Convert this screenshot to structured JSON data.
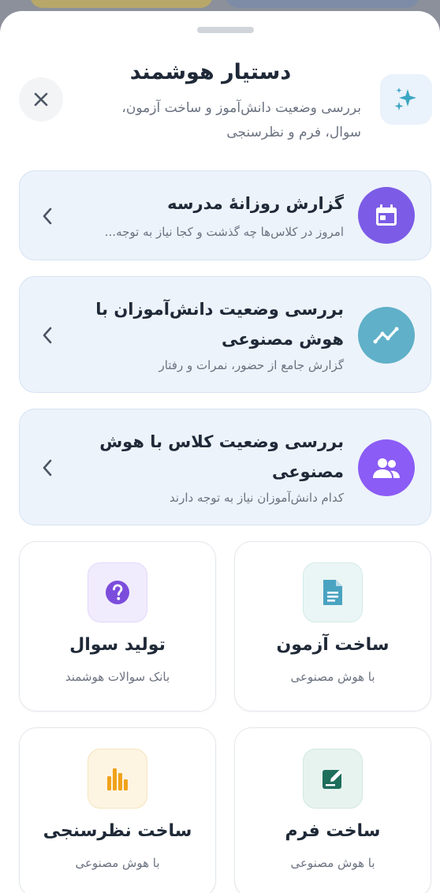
{
  "header": {
    "title": "دستیار هوشمند",
    "subtitle": "بررسی وضعیت دانش‌آموز و ساخت آزمون، سوال، فرم و نظرسنجی"
  },
  "actions": [
    {
      "title": "گزارش روزانهٔ مدرسه",
      "desc": "امروز در کلاس‌ها چه گذشت و کجا نیاز به توجه...",
      "icon": "calendar-icon",
      "color": "#7c5ce6"
    },
    {
      "title": "بررسی وضعیت دانش‌آموزان با هوش مصنوعی",
      "desc": "گزارش جامع از حضور، نمرات و رفتار",
      "icon": "trend-icon",
      "color": "#5fb0c8"
    },
    {
      "title": "بررسی وضعیت کلاس با هوش مصنوعی",
      "desc": "کدام دانش‌آموزان نیاز به توجه دارند",
      "icon": "group-icon",
      "color": "#8b5cf6"
    }
  ],
  "tiles": [
    {
      "label": "ساخت آزمون",
      "sub": "با هوش مصنوعی",
      "icon": "document-icon"
    },
    {
      "label": "تولید سوال",
      "sub": "بانک سوالات هوشمند",
      "icon": "question-icon"
    },
    {
      "label": "ساخت فرم",
      "sub": "با هوش مصنوعی",
      "icon": "edit-form-icon"
    },
    {
      "label": "ساخت نظرسنجی",
      "sub": "با هوش مصنوعی",
      "icon": "bar-chart-icon"
    }
  ]
}
